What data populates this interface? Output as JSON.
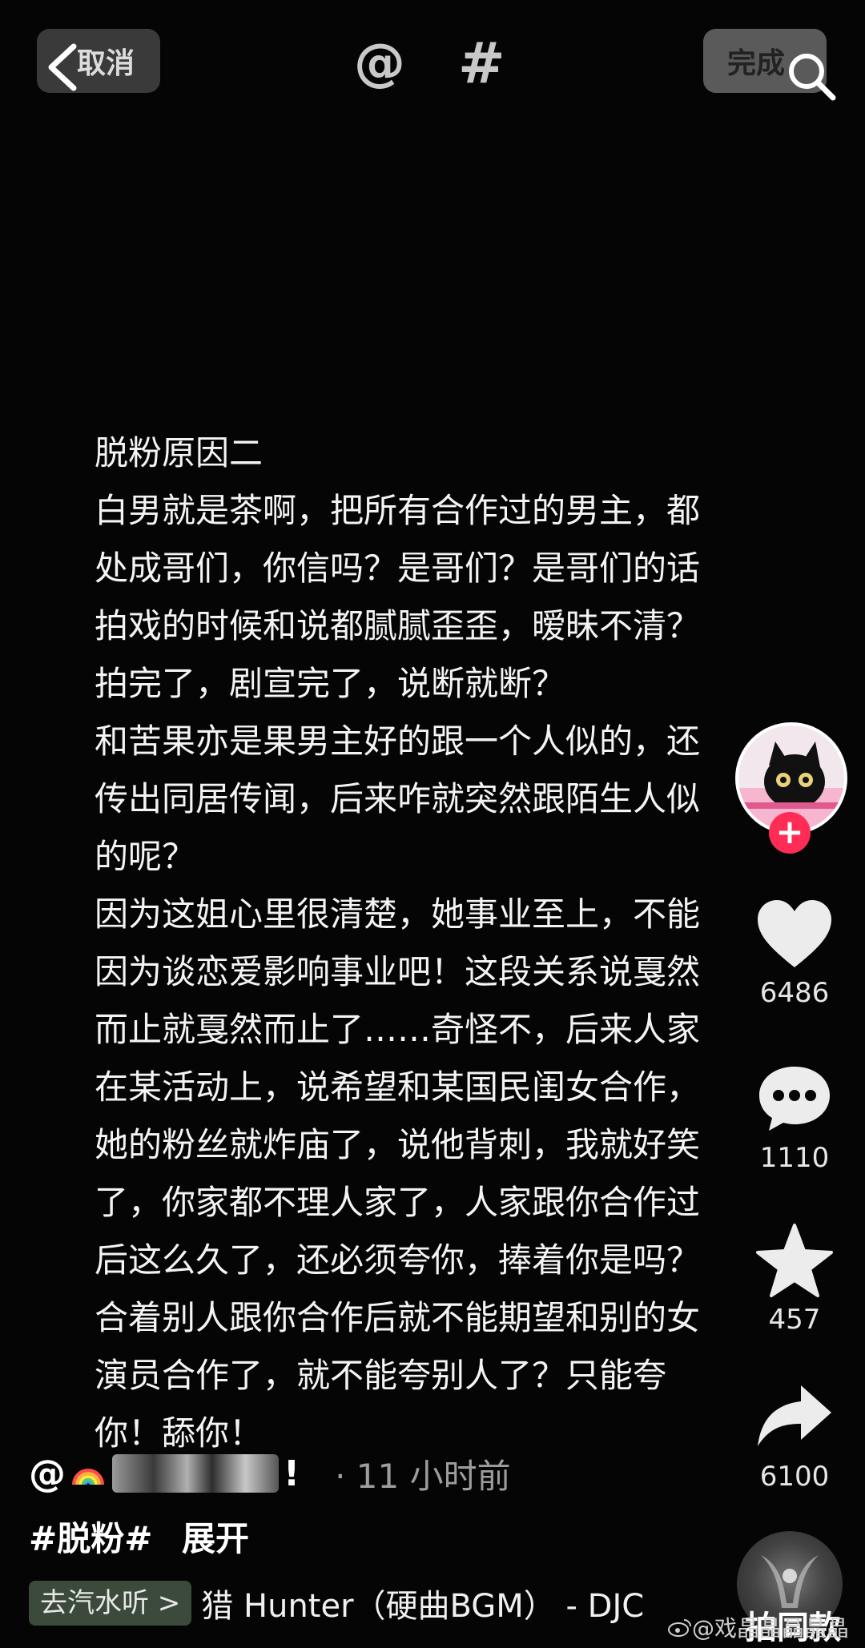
{
  "toolbar": {
    "cancel_label": "取消",
    "mention_symbol": "@",
    "hashtag_symbol": "#",
    "done_label": "完成",
    "icons": {
      "back": "chevron-left-icon",
      "search": "search-icon"
    }
  },
  "post": {
    "lines": [
      "脱粉原因二",
      "白男就是茶啊，把所有合作过的男主，都",
      "处成哥们，你信吗？是哥们？是哥们的话",
      "拍戏的时候和说都腻腻歪歪，暧昧不清？",
      "拍完了，剧宣完了，说断就断？",
      "和苦果亦是果男主好的跟一个人似的，还",
      "传出同居传闻，后来咋就突然跟陌生人似",
      "的呢？",
      "因为这姐心里很清楚，她事业至上，不能",
      "因为谈恋爱影响事业吧！这段关系说戛然",
      "而止就戛然而止了……奇怪不，后来人家",
      "在某活动上，说希望和某国民闺女合作，",
      "她的粉丝就炸庙了，说他背刺，我就好笑",
      "了，你家都不理人家了，人家跟你合作过",
      "后这么久了，还必须夸你，捧着你是吗？",
      "合着别人跟你合作后就不能期望和别的女",
      "演员合作了，就不能夸别人了？只能夸",
      "你！舔你！"
    ]
  },
  "rail": {
    "follow_symbol": "+",
    "like_count": "6486",
    "comment_count": "1110",
    "favorite_count": "457",
    "share_count": "6100"
  },
  "author": {
    "at": "@",
    "name_suffix": "!",
    "time_ago": "· 11 小时前"
  },
  "tags": {
    "hashtag": "#脱粉#",
    "expand_label": "展开"
  },
  "music": {
    "listen_label": "去汽水听 >",
    "title": "猎 Hunter（硬曲BGM） - DJC",
    "same_style_label": "拍同款"
  },
  "watermark": {
    "text": "@戏晶晶晶晶晶"
  },
  "colors": {
    "background": "#050505",
    "follow_red": "#ff2c55",
    "music_link_bg": "#3b4a3b"
  }
}
